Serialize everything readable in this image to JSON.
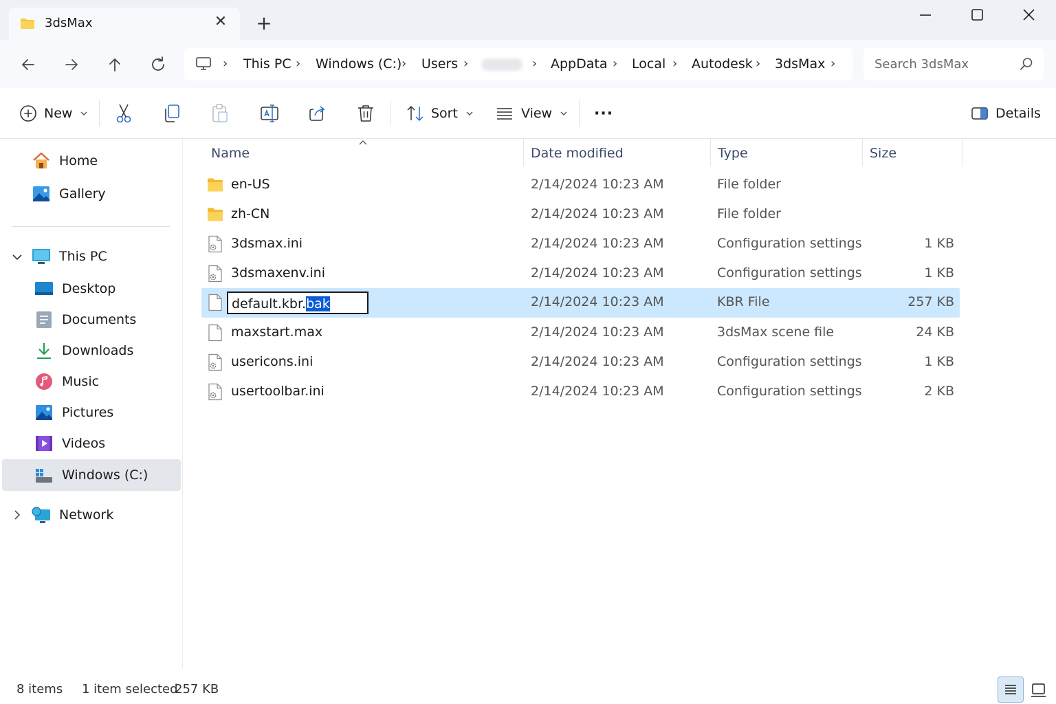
{
  "window": {
    "tab_title": "3dsMax",
    "new_tab": "+",
    "close_tab": "✕"
  },
  "address": {
    "crumbs": [
      "This PC",
      "Windows (C:)",
      "Users",
      "AppData",
      "Local",
      "Autodesk",
      "3dsMax"
    ],
    "search_placeholder": "Search 3dsMax"
  },
  "toolbar": {
    "new_label": "New",
    "sort_label": "Sort",
    "view_label": "View",
    "more_label": "···",
    "details_label": "Details"
  },
  "sidebar": {
    "home": "Home",
    "gallery": "Gallery",
    "this_pc": "This PC",
    "desktop": "Desktop",
    "documents": "Documents",
    "downloads": "Downloads",
    "music": "Music",
    "pictures": "Pictures",
    "videos": "Videos",
    "windows_c": "Windows (C:)",
    "network": "Network"
  },
  "columns": {
    "name": "Name",
    "date": "Date modified",
    "type": "Type",
    "size": "Size"
  },
  "files": [
    {
      "name": "en-US",
      "date": "2/14/2024 10:23 AM",
      "type": "File folder",
      "size": "",
      "icon": "folder-icon"
    },
    {
      "name": "zh-CN",
      "date": "2/14/2024 10:23 AM",
      "type": "File folder",
      "size": "",
      "icon": "folder-icon"
    },
    {
      "name": "3dsmax.ini",
      "date": "2/14/2024 10:23 AM",
      "type": "Configuration settings",
      "size": "1 KB",
      "icon": "settings-file-icon"
    },
    {
      "name": "3dsmaxenv.ini",
      "date": "2/14/2024 10:23 AM",
      "type": "Configuration settings",
      "size": "1 KB",
      "icon": "settings-file-icon"
    },
    {
      "name": "default.kbr.bak",
      "date": "2/14/2024 10:23 AM",
      "type": "KBR File",
      "size": "257 KB",
      "icon": "file-icon"
    },
    {
      "name": "maxstart.max",
      "date": "2/14/2024 10:23 AM",
      "type": "3dsMax scene file",
      "size": "24 KB",
      "icon": "file-icon"
    },
    {
      "name": "usericons.ini",
      "date": "2/14/2024 10:23 AM",
      "type": "Configuration settings",
      "size": "1 KB",
      "icon": "settings-file-icon"
    },
    {
      "name": "usertoolbar.ini",
      "date": "2/14/2024 10:23 AM",
      "type": "Configuration settings",
      "size": "2 KB",
      "icon": "settings-file-icon"
    }
  ],
  "rename": {
    "prefix": "default.kbr.",
    "selected": "bak"
  },
  "status": {
    "items": "8 items",
    "selected": "1 item selected",
    "selected_size": "257 KB"
  },
  "colors": {
    "selection": "#cce8ff",
    "accent": "#0a5bd8",
    "folder": "#f8c63d"
  }
}
